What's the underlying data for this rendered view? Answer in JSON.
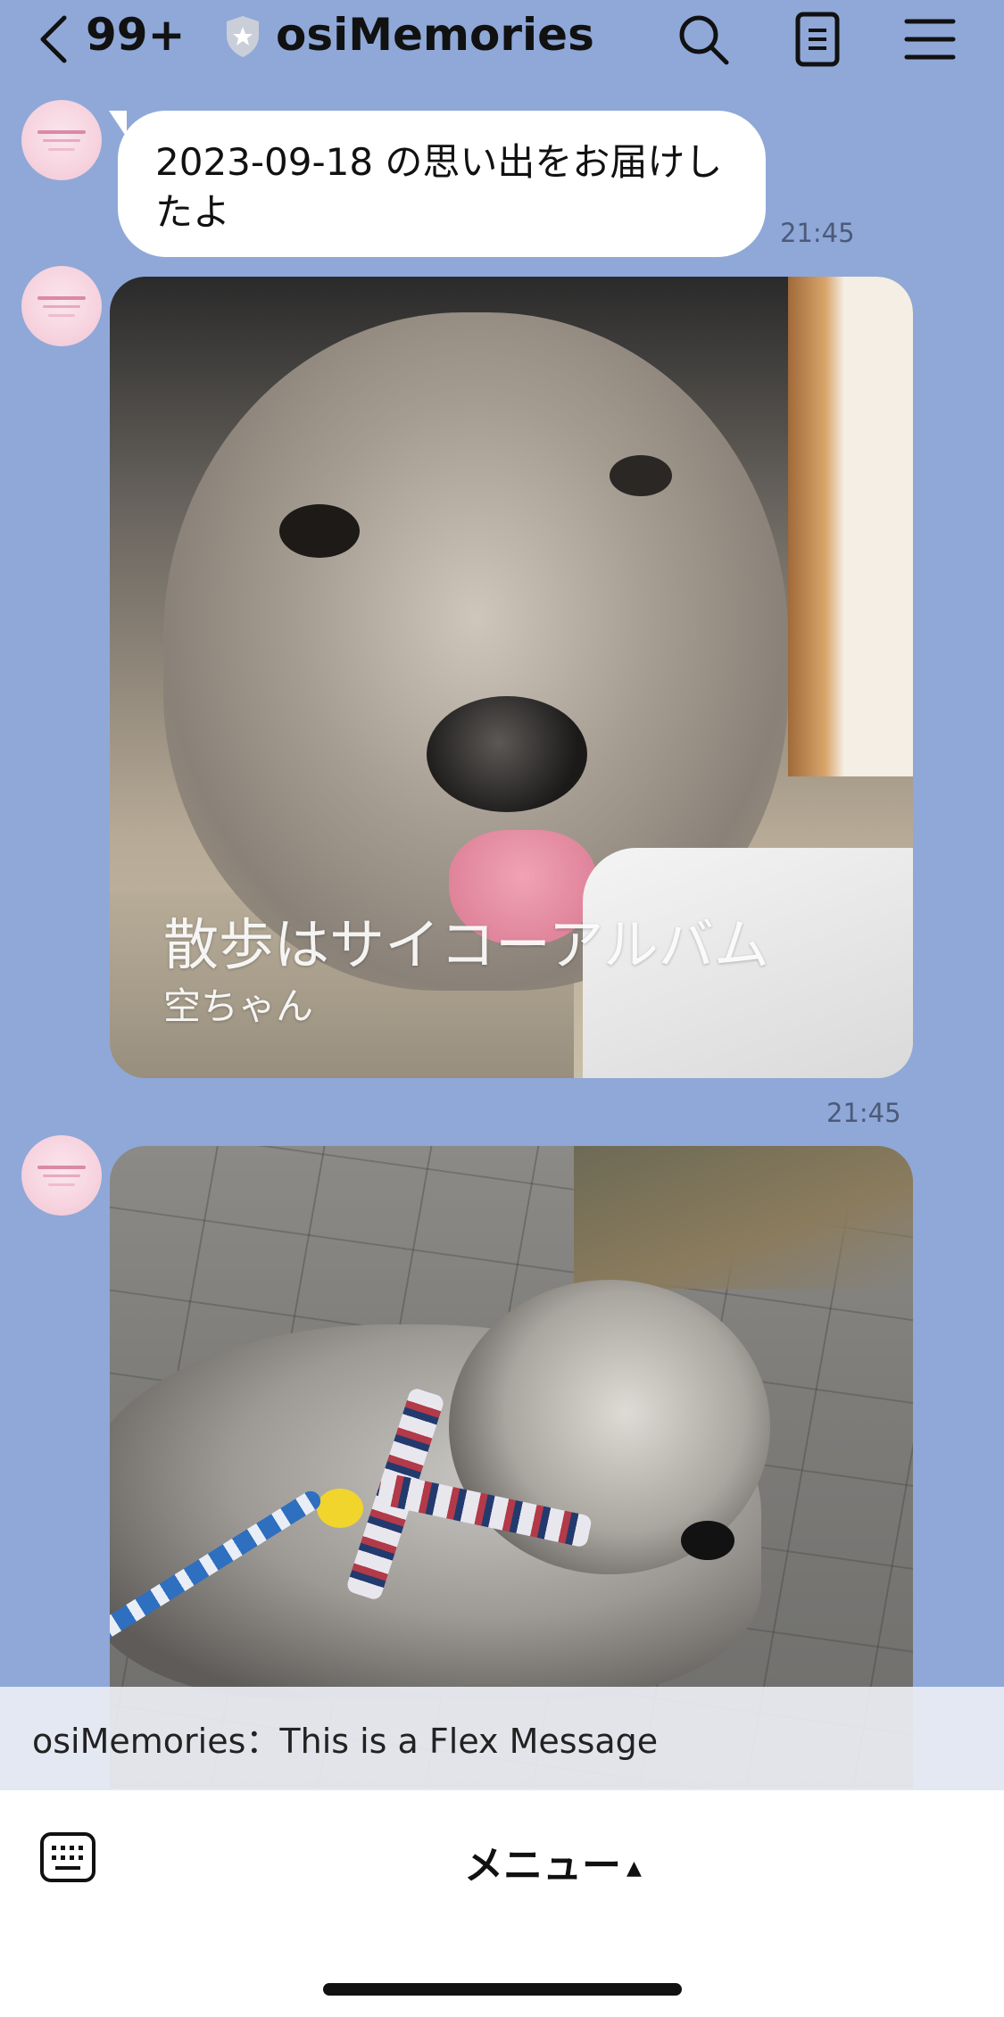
{
  "header": {
    "unread_count": "99+",
    "title": "osiMemories"
  },
  "messages": [
    {
      "type": "text",
      "text": "2023-09-18 の思い出をお届けしたよ",
      "time": "21:45"
    },
    {
      "type": "image_card",
      "title": "散歩はサイコーアルバム",
      "subtitle": "空ちゃん",
      "time": "21:45"
    },
    {
      "type": "image_card",
      "title": "",
      "subtitle": ""
    }
  ],
  "notification": {
    "text": "osiMemories：This is a Flex Message"
  },
  "bottom_bar": {
    "menu_label": "メニュー",
    "menu_caret": "▲"
  },
  "colors": {
    "chat_background": "#8fa8d8",
    "bubble": "#ffffff"
  }
}
